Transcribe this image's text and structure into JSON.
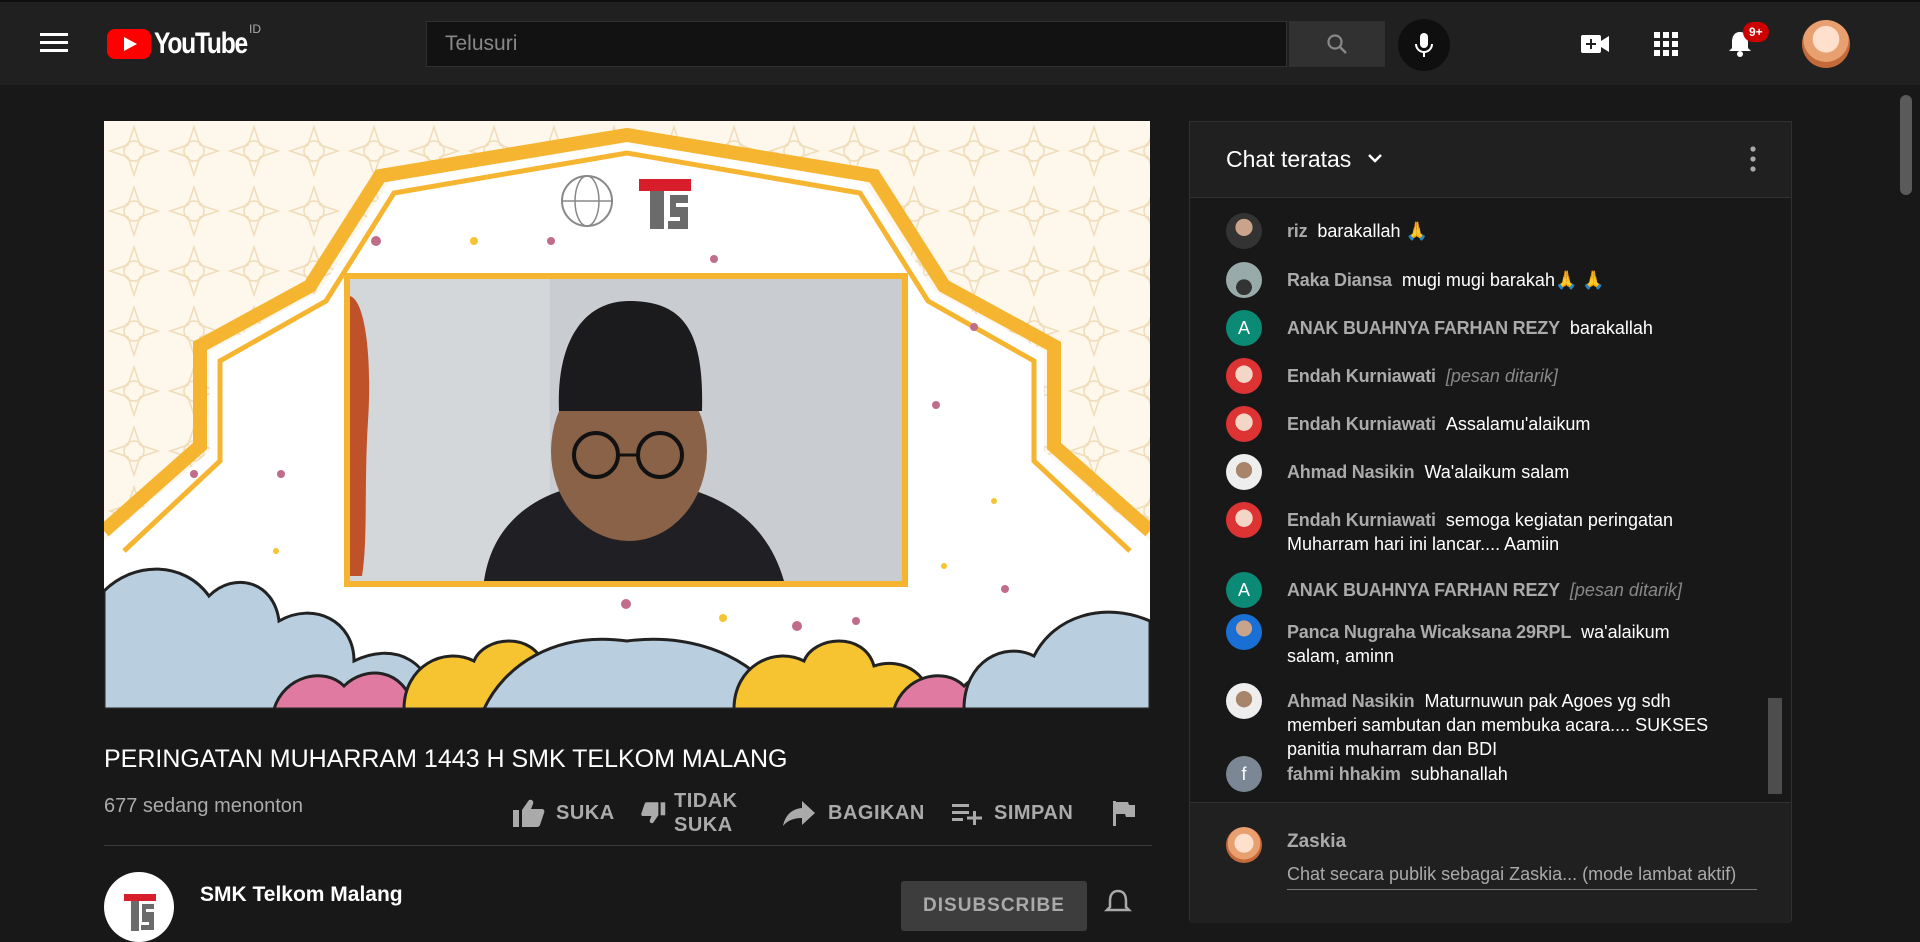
{
  "masthead": {
    "logo_text": "YouTube",
    "country_code": "ID",
    "search_placeholder": "Telusuri",
    "notification_count": "9+"
  },
  "video": {
    "title": "PERINGATAN MUHARRAM 1443 H SMK TELKOM MALANG",
    "views": "677 sedang menonton",
    "actions": {
      "like": "SUKA",
      "dislike_line1": "TIDAK",
      "dislike_line2": "SUKA",
      "share": "BAGIKAN",
      "save": "SIMPAN"
    },
    "channel_name": "SMK Telkom Malang",
    "subscribe_label": "DISUBSCRIBE"
  },
  "chat": {
    "title": "Chat teratas",
    "messages": [
      {
        "author": "riz",
        "text": "barakallah 🙏"
      },
      {
        "author": "Raka Diansa",
        "text": "mugi mugi barakah🙏 🙏"
      },
      {
        "author": "ANAK BUAHNYA FARHAN REZY",
        "text": "barakallah",
        "initial": "A"
      },
      {
        "author": "Endah Kurniawati",
        "text": "[pesan ditarik]"
      },
      {
        "author": "Endah Kurniawati",
        "text": "Assalamu'alaikum"
      },
      {
        "author": "Ahmad Nasikin",
        "text": "Wa'alaikum salam"
      },
      {
        "author": "Endah Kurniawati",
        "text": "semoga kegiatan peringatan Muharram hari ini lancar.... Aamiin"
      },
      {
        "author": "ANAK BUAHNYA FARHAN REZY",
        "text": "[pesan ditarik]",
        "initial": "A"
      },
      {
        "author": "Panca Nugraha Wicaksana 29RPL",
        "text": "wa'alaikum salam, aminn"
      },
      {
        "author": "Ahmad Nasikin",
        "text": "Maturnuwun pak Agoes yg sdh memberi sambutan dan membuka acara.... SUKSES panitia muharram dan BDI"
      },
      {
        "author": "fahmi hhakim",
        "text": "subhanallah",
        "initial": "f"
      }
    ],
    "composer_user": "Zaskia",
    "composer_placeholder": "Chat secara publik sebagai Zaskia... (mode lambat aktif)"
  },
  "colors": {
    "brand_red": "#ff0000",
    "background": "#181818",
    "masthead": "#202020",
    "avatar_teal": "#0b8a76",
    "avatar_gray": "#7b8794"
  }
}
